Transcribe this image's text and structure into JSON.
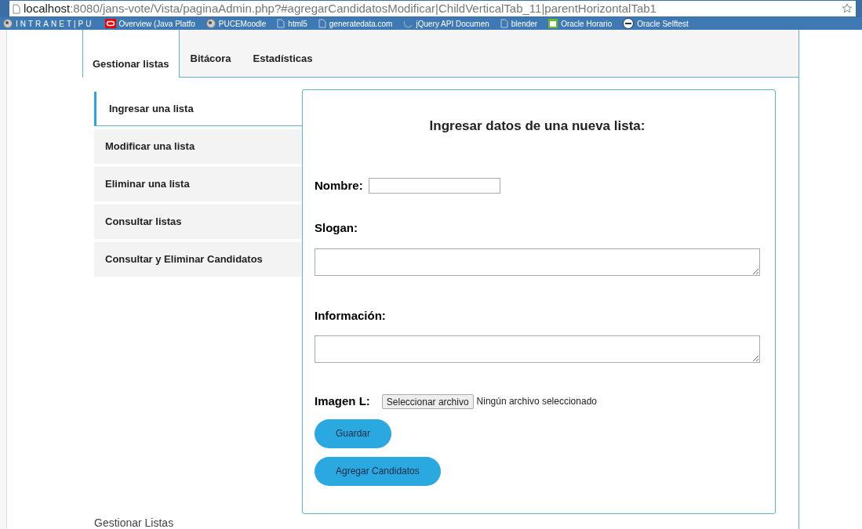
{
  "browser": {
    "url_host": "localhost",
    "url_path": ":8080/jans-vote/Vista/paginaAdmin.php?#agregarCandidatosModificar|ChildVerticalTab_11|parentHorizontalTab1"
  },
  "bookmarks": [
    {
      "label": "INTRANET|PU",
      "kind": "globe"
    },
    {
      "label": "Overview (Java Platfo",
      "kind": "oracle"
    },
    {
      "label": "PUCEMoodle",
      "kind": "globe"
    },
    {
      "label": "html5",
      "kind": "page"
    },
    {
      "label": "generatedata.com",
      "kind": "page"
    },
    {
      "label": "jQuery API Documen",
      "kind": "jquery"
    },
    {
      "label": "blender",
      "kind": "page"
    },
    {
      "label": "Oracle Horario",
      "kind": "sheet"
    },
    {
      "label": "Oracle Selftest",
      "kind": "st"
    }
  ],
  "tabs": [
    {
      "label": "Gestionar listas",
      "selected": true
    },
    {
      "label": "Bitácora",
      "selected": false
    },
    {
      "label": "Estadísticas",
      "selected": false
    }
  ],
  "side_tabs": [
    {
      "label": "Ingresar una lista",
      "selected": true
    },
    {
      "label": "Modificar una lista",
      "selected": false
    },
    {
      "label": "Eliminar una lista",
      "selected": false
    },
    {
      "label": "Consultar listas",
      "selected": false
    },
    {
      "label": "Consultar y Eliminar Candidatos",
      "selected": false
    }
  ],
  "form": {
    "title": "Ingresar datos de una nueva lista:",
    "nombre_label": "Nombre:",
    "slogan_label": "Slogan:",
    "informacion_label": "Información:",
    "imagen_label": "Imagen L:",
    "file_button": "Seleccionar archivo",
    "file_status": "Ningún archivo seleccionado",
    "buttons": [
      "Guardar",
      "Agregar Candidatos"
    ]
  },
  "footer": "Gestionar Listas"
}
